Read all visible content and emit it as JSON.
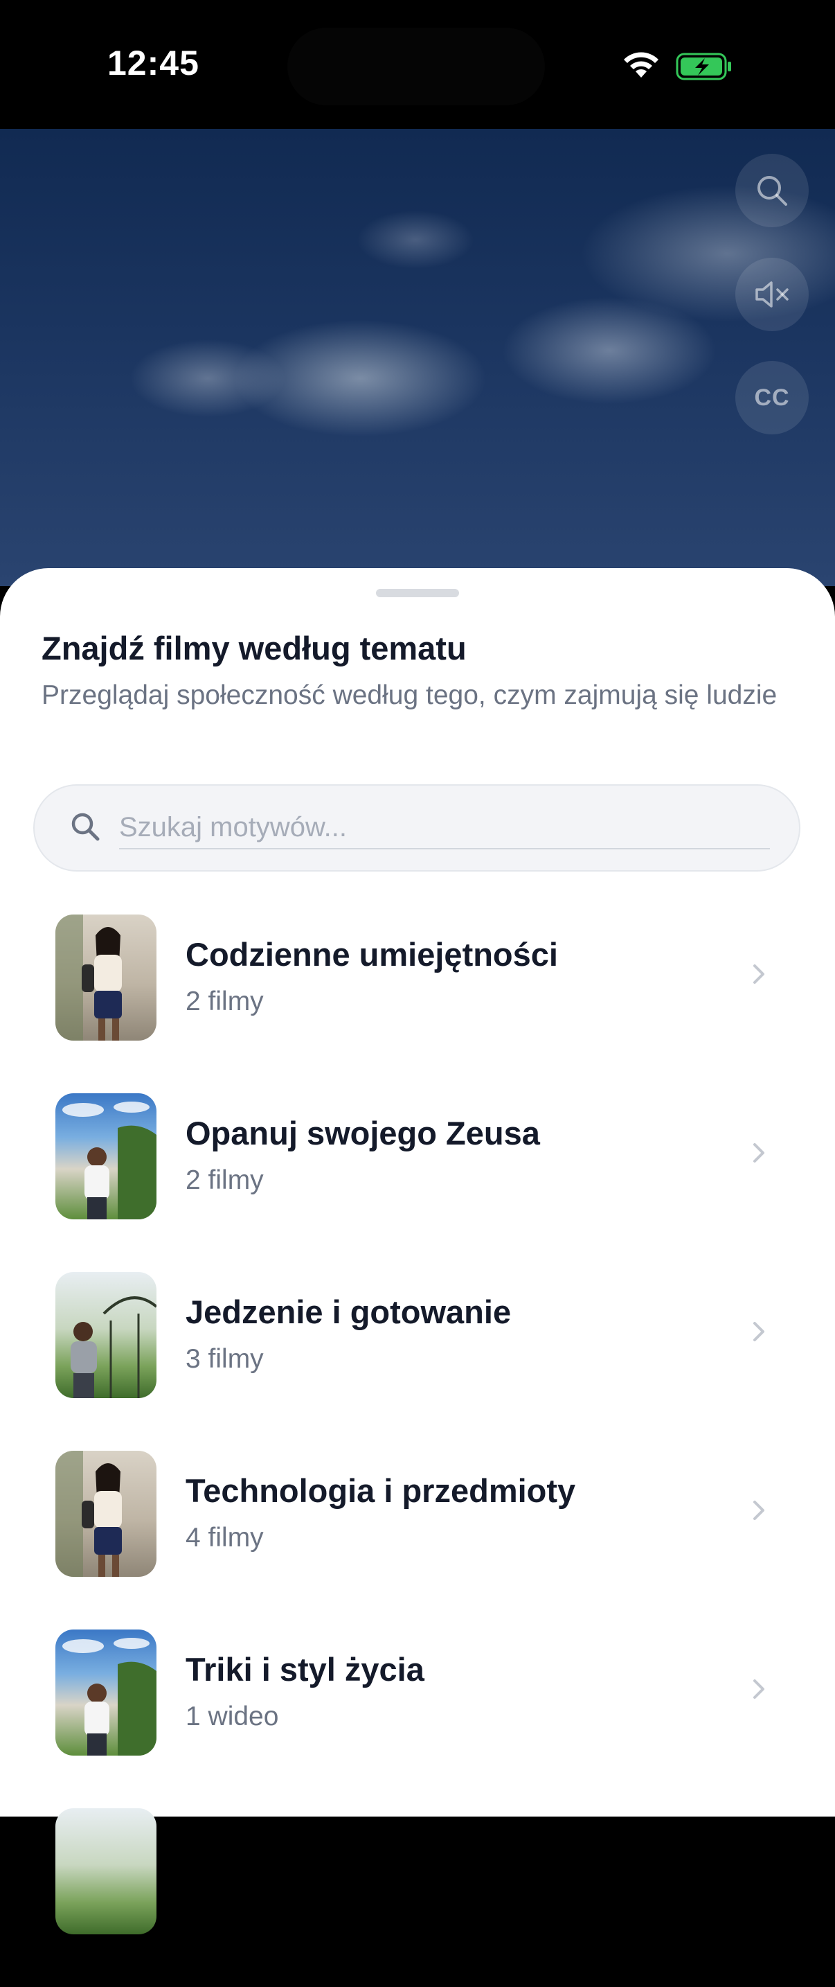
{
  "status_bar": {
    "time": "12:45"
  },
  "video_controls": {
    "cc_label": "CC"
  },
  "sheet": {
    "title": "Znajdź filmy według tematu",
    "subtitle": "Przeglądaj społeczność według tego, czym zajmują się ludzie",
    "search": {
      "placeholder": "Szukaj motywów...",
      "value": ""
    },
    "topics": [
      {
        "title": "Codzienne umiejętności",
        "count": "2 filmy"
      },
      {
        "title": "Opanuj swojego Zeusa",
        "count": "2 filmy"
      },
      {
        "title": "Jedzenie i gotowanie",
        "count": "3 filmy"
      },
      {
        "title": "Technologia i przedmioty",
        "count": "4 filmy"
      },
      {
        "title": "Triki i styl życia",
        "count": "1 wideo"
      }
    ]
  },
  "colors": {
    "accent_battery": "#34c759",
    "title_text": "#141a2a",
    "secondary_text": "#6b7383"
  }
}
